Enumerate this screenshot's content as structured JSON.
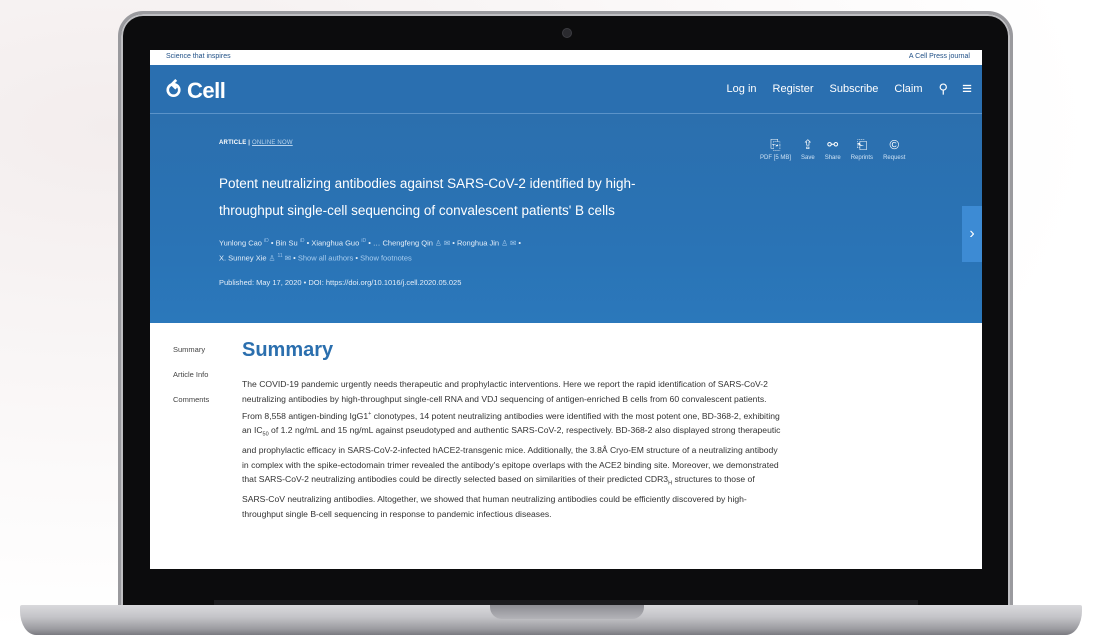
{
  "topstrip": {
    "left": "Science that inspires",
    "right": "A Cell Press journal"
  },
  "nav": {
    "logo": "Cell",
    "links": [
      "Log in",
      "Register",
      "Subscribe",
      "Claim"
    ],
    "icons": [
      "search-icon",
      "menu-icon"
    ]
  },
  "article": {
    "tag": "ARTICLE",
    "tag_sep": " | ",
    "status": "ONLINE NOW",
    "title": "Potent neutralizing antibodies against SARS-CoV-2 identified by high-throughput single-cell sequencing of convalescent patients' B cells",
    "authors_line1": [
      "Yunlong Cao",
      "Bin Su",
      "Xianghua Guo",
      "…",
      "Chengfeng Qin",
      "Ronghua Jin"
    ],
    "authors_line2": "X. Sunney Xie",
    "show_all": "Show all authors",
    "show_footnotes": "Show footnotes",
    "published": "Published: May 17, 2020",
    "doi": "DOI: https://doi.org/10.1016/j.cell.2020.05.025"
  },
  "tools": [
    {
      "label": "PDF [5 MB]",
      "icon": "pdf-icon"
    },
    {
      "label": "Save",
      "icon": "save-icon"
    },
    {
      "label": "Share",
      "icon": "share-icon"
    },
    {
      "label": "Reprints",
      "icon": "reprints-icon"
    },
    {
      "label": "Request",
      "icon": "copyright-icon"
    }
  ],
  "sidenav": [
    "Summary",
    "Article Info",
    "Comments"
  ],
  "summary": {
    "heading": "Summary",
    "text_a": "The COVID-19 pandemic urgently needs therapeutic and prophylactic interventions. Here we report the rapid identification of SARS-CoV-2 neutralizing antibodies by high-throughput single-cell RNA and VDJ sequencing of antigen-enriched B cells from 60 convalescent patients. From 8,558 antigen-binding IgG1",
    "sup1": "+",
    "text_b": " clonotypes, 14 potent neutralizing antibodies were identified with the most potent one, BD-368-2, exhibiting an IC",
    "sub1": "50",
    "text_c": " of 1.2 ng/mL and 15 ng/mL against pseudotyped and authentic SARS-CoV-2, respectively. BD-368-2 also displayed strong therapeutic and prophylactic efficacy in SARS-CoV-2-infected hACE2-transgenic mice. Additionally, the 3.8Å Cryo-EM structure of a neutralizing antibody in complex with the spike-ectodomain trimer revealed the antibody's epitope overlaps with the ACE2 binding site. Moreover, we demonstrated that SARS-CoV-2 neutralizing antibodies could be directly selected based on similarities of their predicted CDR3",
    "sub2": "H",
    "text_d": " structures to those of SARS-CoV neutralizing antibodies. Altogether, we showed that human neutralizing antibodies could be efficiently discovered by high-throughput single B-cell sequencing in response to pandemic infectious diseases."
  }
}
